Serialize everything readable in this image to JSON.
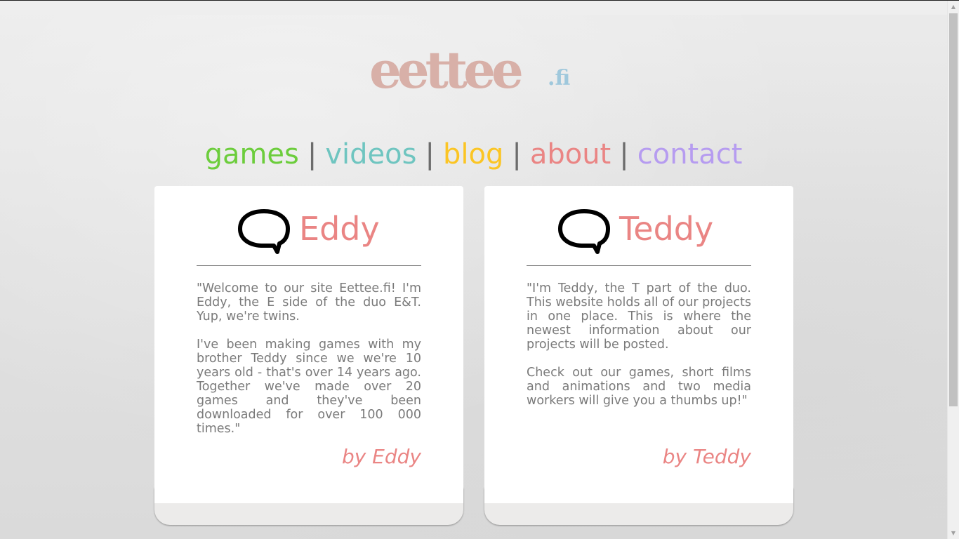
{
  "logo": {
    "main": "eettee",
    "ext": ".fi"
  },
  "nav": {
    "items": [
      {
        "label": "games",
        "color": "#6ccd3c"
      },
      {
        "label": "videos",
        "color": "#6fc5c0"
      },
      {
        "label": "blog",
        "color": "#fbc524"
      },
      {
        "label": "about",
        "color": "#ea8584"
      },
      {
        "label": "contact",
        "color": "#b69cf0"
      }
    ],
    "separator": "|"
  },
  "cards": [
    {
      "name": "Eddy",
      "icon": "speech-bubble-icon",
      "paragraphs": [
        "\"Welcome to our site Eettee.fi! I'm Eddy, the E side of the duo E&T. Yup, we're twins.",
        "I've been making games with my brother Teddy since we we're 10 years old - that's over 14 years ago. Together we've made over 20 games and they've been downloaded for over 100 000 times.\""
      ],
      "signature": "by Eddy"
    },
    {
      "name": "Teddy",
      "icon": "speech-bubble-icon",
      "paragraphs": [
        "\"I'm Teddy, the T part of the duo. This website holds all of our projects in one place. This is where the newest information about our projects will be posted.",
        "Check out our games, short films and animations and two media workers will give you a thumbs up!\""
      ],
      "signature": "by Teddy"
    }
  ],
  "colors": {
    "accent": "#ea8584",
    "text": "#7a7a7a",
    "logo": "#d8b0a8",
    "logo_ext": "#9fc8dc"
  }
}
